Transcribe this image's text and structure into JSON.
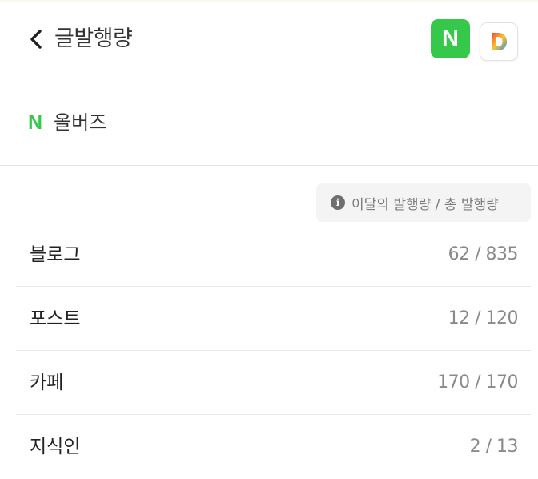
{
  "header": {
    "title": "글발행량",
    "naver_button_label": "N",
    "daum_button_label": "D"
  },
  "account": {
    "mark": "N",
    "name": "올버즈"
  },
  "legend": {
    "text": "이달의 발행량 / 총 발행량",
    "icon": "info-icon"
  },
  "rows": [
    {
      "label": "블로그",
      "value": "62 / 835"
    },
    {
      "label": "포스트",
      "value": "12 / 120"
    },
    {
      "label": "카페",
      "value": "170 / 170"
    },
    {
      "label": "지식인",
      "value": "2 / 13"
    }
  ],
  "colors": {
    "naver_green": "#35c84a",
    "daum_blue": "#2f8bf3",
    "daum_red": "#f04a3e",
    "daum_yellow": "#f9c52a"
  }
}
